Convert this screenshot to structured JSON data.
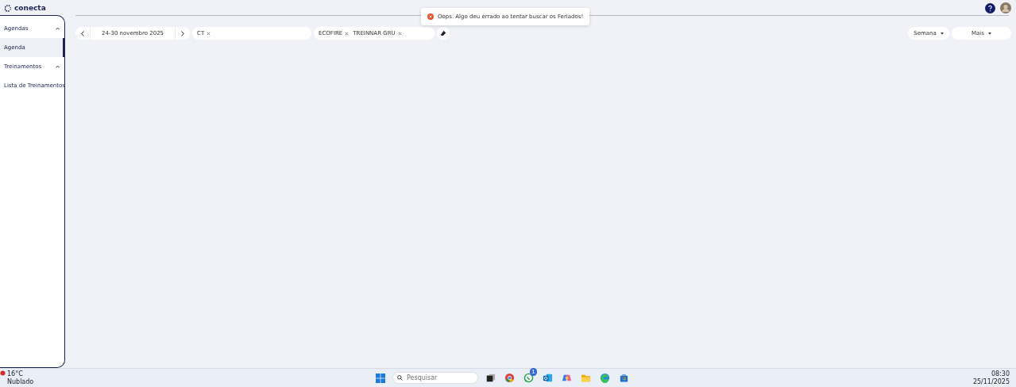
{
  "app": {
    "logo": "conecta"
  },
  "sidebar": {
    "groups": [
      {
        "label": "Agendas",
        "expanded": true,
        "items": [
          {
            "label": "Agenda",
            "selected": true
          }
        ]
      },
      {
        "label": "Treinamentos",
        "expanded": true,
        "items": [
          {
            "label": "Lista de Treinamentos",
            "selected": false
          }
        ]
      }
    ]
  },
  "toolbar": {
    "date_range": "24-30 novembro 2025",
    "filters": [
      {
        "chips": [
          "CT"
        ]
      },
      {
        "chips": [
          "ECOFIRE",
          "TREINNAR GRU"
        ]
      }
    ],
    "view": "Semana",
    "more": "Mais"
  },
  "toast": {
    "message": "Oops. Algo deu errado ao tentar buscar os Feriados!"
  },
  "taskbar": {
    "weather": {
      "temp": "16°C",
      "condition": "Nublado"
    },
    "search": {
      "placeholder": "Pesquisar"
    },
    "apps": [
      {
        "kind": "taskview"
      },
      {
        "kind": "chrome"
      },
      {
        "kind": "whatsapp",
        "badge": "1"
      },
      {
        "kind": "outlook"
      },
      {
        "kind": "copilot"
      },
      {
        "kind": "files"
      },
      {
        "kind": "edge"
      },
      {
        "kind": "store"
      }
    ],
    "time": "08:30",
    "date": "25/11/2025"
  }
}
